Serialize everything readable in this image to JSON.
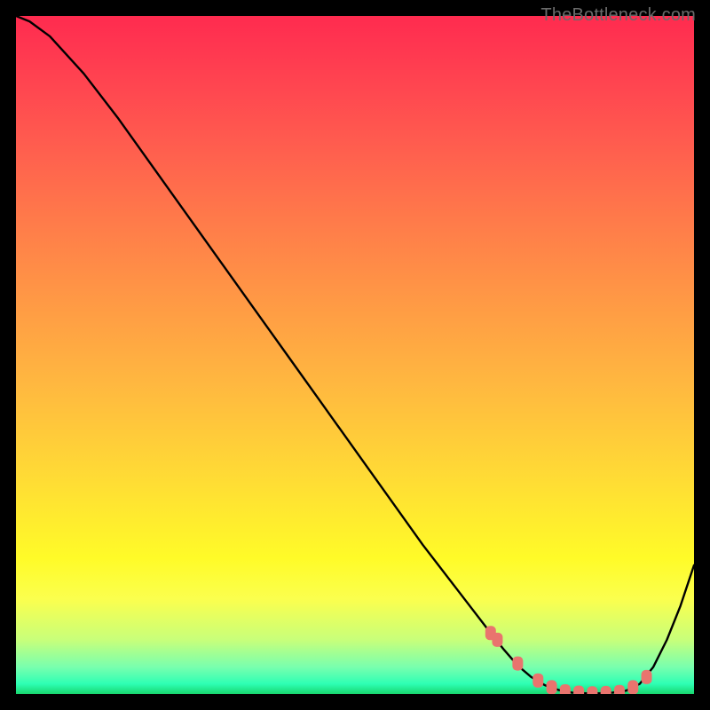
{
  "watermark": "TheBottleneck.com",
  "chart_data": {
    "type": "line",
    "title": "",
    "xlabel": "",
    "ylabel": "",
    "xlim": [
      0,
      100
    ],
    "ylim": [
      0,
      100
    ],
    "grid": false,
    "legend": false,
    "series": [
      {
        "name": "curve",
        "x": [
          0,
          2,
          5,
          10,
          15,
          20,
          25,
          30,
          35,
          40,
          45,
          50,
          55,
          60,
          65,
          70,
          72,
          74,
          76,
          78,
          80,
          82,
          84,
          86,
          88,
          90,
          92,
          94,
          96,
          98,
          100
        ],
        "y": [
          100,
          99.2,
          97.0,
          91.5,
          85.0,
          78.0,
          71.0,
          64.0,
          57.0,
          50.0,
          43.0,
          36.0,
          29.0,
          22.0,
          15.5,
          9.0,
          6.5,
          4.2,
          2.5,
          1.3,
          0.6,
          0.2,
          0.1,
          0.1,
          0.2,
          0.5,
          1.5,
          4.0,
          8.0,
          13.0,
          19.0
        ]
      },
      {
        "name": "markers",
        "x": [
          70,
          71,
          74,
          77,
          79,
          81,
          83,
          85,
          87,
          89,
          91,
          93
        ],
        "y": [
          9.0,
          8.0,
          4.5,
          2.0,
          1.0,
          0.4,
          0.2,
          0.1,
          0.15,
          0.3,
          1.0,
          2.5
        ]
      }
    ]
  }
}
